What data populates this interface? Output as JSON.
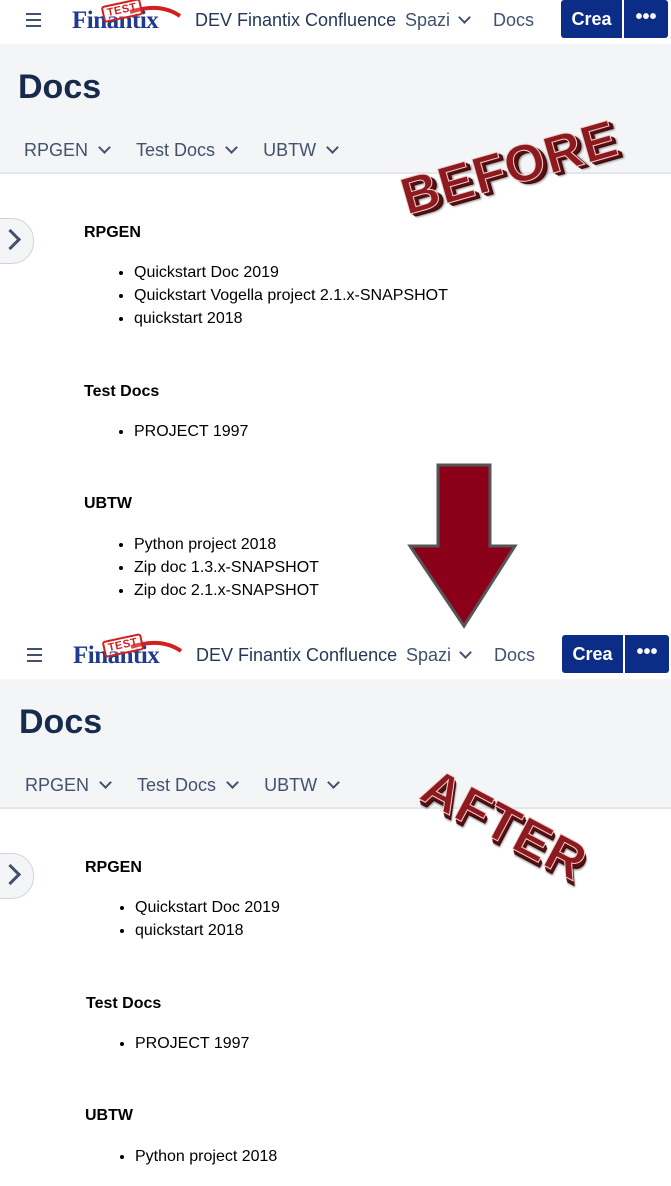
{
  "header": {
    "menu_icon": "hamburger-menu-icon",
    "logo_text": "Finantix",
    "logo_stamp": "TEST",
    "app_title": "DEV Finantix Confluence",
    "spaces_label": "Spazi",
    "docs_label": "Docs",
    "create_label": "Crea",
    "more_label": "•••",
    "colors": {
      "primary": "#0c2d87",
      "hero_bg": "#f4f5f7"
    }
  },
  "page": {
    "title": "Docs",
    "tabs": [
      {
        "label": "RPGEN"
      },
      {
        "label": "Test Docs"
      },
      {
        "label": "UBTW"
      }
    ]
  },
  "before": {
    "overlay_label": "BEFORE",
    "sections": [
      {
        "title": "RPGEN",
        "items": [
          "Quickstart Doc 2019",
          "Quickstart Vogella project 2.1.x-SNAPSHOT",
          "quickstart 2018"
        ]
      },
      {
        "title": "Test Docs",
        "items": [
          "PROJECT 1997"
        ]
      },
      {
        "title": "UBTW",
        "items": [
          "Python project 2018",
          "Zip doc 1.3.x-SNAPSHOT",
          "Zip doc 2.1.x-SNAPSHOT"
        ]
      }
    ]
  },
  "after": {
    "overlay_label": "AFTER",
    "sections": [
      {
        "title": "RPGEN",
        "items": [
          "Quickstart Doc 2019",
          "quickstart 2018"
        ]
      },
      {
        "title": "Test Docs",
        "items": [
          "PROJECT 1997"
        ]
      },
      {
        "title": "UBTW",
        "items": [
          "Python project 2018"
        ]
      }
    ]
  },
  "annotation": {
    "arrow_color": "#8b0018",
    "arrow_icon": "down-arrow-icon"
  }
}
